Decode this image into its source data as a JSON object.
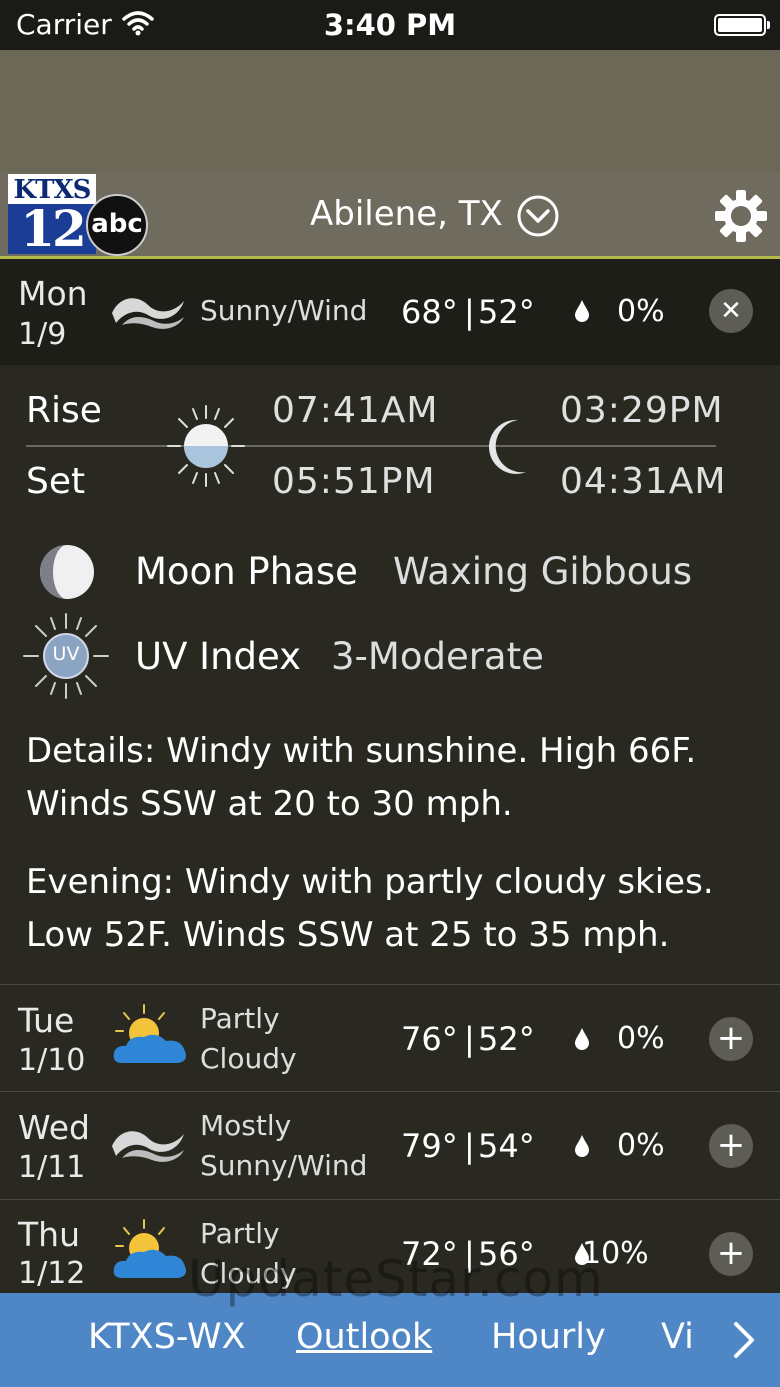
{
  "status_bar": {
    "carrier": "Carrier",
    "time": "3:40 PM"
  },
  "header": {
    "logo_call": "KTXS",
    "logo_num": "12",
    "logo_network": "abc",
    "city": "Abilene, TX"
  },
  "today": {
    "day": "Mon",
    "date": "1/9",
    "condition": "Sunny/Wind",
    "icon": "wind-icon",
    "high": "68°",
    "sep": "|",
    "low": "52°",
    "precip": "0%",
    "close": "✕"
  },
  "sun_moon": {
    "rise_label": "Rise",
    "set_label": "Set",
    "sunrise": "07:41AM",
    "sunset": "05:51PM",
    "moonrise": "03:29PM",
    "moonset": "04:31AM"
  },
  "moon_phase": {
    "label": "Moon Phase",
    "value": "Waxing Gibbous"
  },
  "uv": {
    "badge": "UV",
    "label": "UV Index",
    "value": "3-Moderate"
  },
  "details": {
    "day_line1": "Details: Windy with sunshine. High 66F.",
    "day_line2": "Winds SSW at 20 to 30 mph.",
    "eve_line1": "Evening: Windy with partly cloudy skies.",
    "eve_line2": "Low 52F. Winds SSW at 25 to 35 mph."
  },
  "forecast": [
    {
      "day": "Tue",
      "date": "1/10",
      "cond1": "Partly",
      "cond2": "Cloudy",
      "icon": "partly-cloudy-icon",
      "high": "76°",
      "low": "52°",
      "precip": "0%"
    },
    {
      "day": "Wed",
      "date": "1/11",
      "cond1": "Mostly",
      "cond2": "Sunny/Wind",
      "icon": "wind-icon",
      "high": "79°",
      "low": "54°",
      "precip": "0%"
    },
    {
      "day": "Thu",
      "date": "1/12",
      "cond1": "Partly",
      "cond2": "Cloudy",
      "icon": "partly-cloudy-icon",
      "high": "72°",
      "low": "56°",
      "precip": "10%"
    }
  ],
  "expand_symbol": "+",
  "nav": {
    "items": [
      "KTXS-WX",
      "Outlook",
      "Hourly",
      "Vi"
    ],
    "active": "Outlook"
  },
  "watermark": "UpdateStar.com",
  "colors": {
    "nav_bg": "#4f87c6",
    "header_bg": "#6f6b5e",
    "accent_line": "#b5b84a",
    "body_bg": "#2a2921"
  }
}
